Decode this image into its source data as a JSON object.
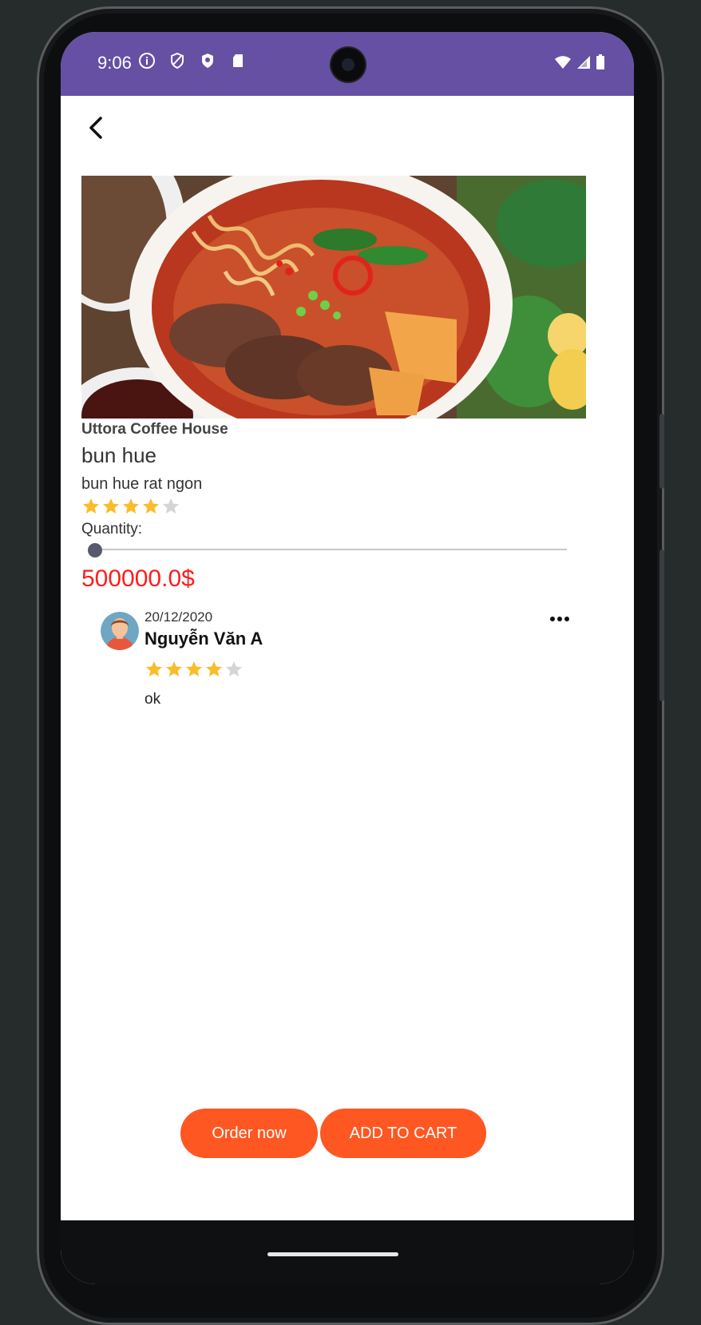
{
  "status_bar": {
    "time": "9:06",
    "left_icons": [
      "info-icon",
      "shield-outline-icon",
      "shield-icon",
      "sd-card-icon"
    ],
    "right_icons": [
      "wifi-icon",
      "cell-signal-icon",
      "battery-icon"
    ],
    "background": "#6550a4"
  },
  "product": {
    "image_name": "bun-hue-photo",
    "restaurant": "Uttora Coffee House",
    "name": "bun hue",
    "description": "bun hue rat ngon",
    "rating": 4,
    "rating_max": 5,
    "quantity_label": "Quantity:",
    "quantity_slider_fraction": 0,
    "price": "500000.0$",
    "price_color": "#ff1c1c"
  },
  "reviews": [
    {
      "date": "20/12/2020",
      "name": "Nguyễn Văn A",
      "rating": 4,
      "rating_max": 5,
      "text": "ok"
    }
  ],
  "actions": {
    "order_now": "Order now",
    "add_to_cart": "ADD TO CART",
    "accent": "#ff5722"
  },
  "colors": {
    "star_filled": "#fbbc2a",
    "star_empty": "#d5d5d5"
  }
}
